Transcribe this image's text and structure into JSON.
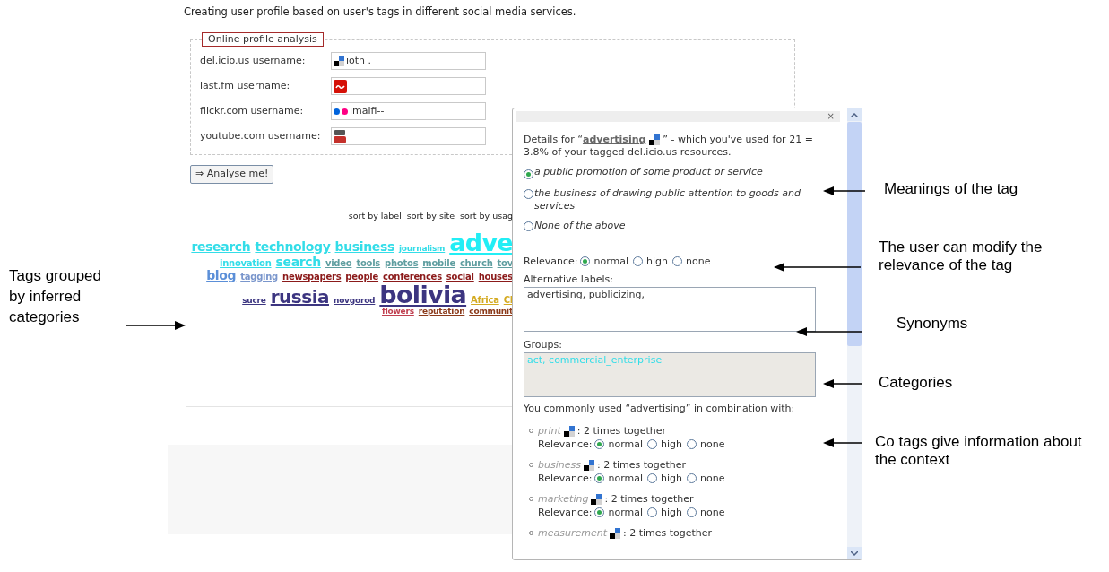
{
  "heading": "Creating user profile based on user's tags in different social media services.",
  "profile_form": {
    "legend": "Online profile analysis",
    "fields": [
      {
        "label": "del.icio.us username:",
        "kind": "delicious",
        "value": "ıoth ."
      },
      {
        "label": "last.fm username:",
        "kind": "lastfm"
      },
      {
        "label": "flickr.com username:",
        "kind": "flickr",
        "value": "ımalfi--"
      },
      {
        "label": "youtube.com username:",
        "kind": "youtube"
      }
    ],
    "submit": "⇒ Analyse me!"
  },
  "sort_links": [
    "sort by label",
    "sort by site",
    "sort by usag"
  ],
  "tag_cloud": [
    [
      {
        "label": "research",
        "color": "#33dde8",
        "kind": "m"
      },
      {
        "label": "technology",
        "color": "#33dde8",
        "kind": "m"
      },
      {
        "label": "business",
        "color": "#33dde8",
        "kind": "m"
      },
      {
        "label": "journalism",
        "color": "#33dde8",
        "kind": "xs"
      },
      {
        "label": "adve",
        "color": "#22eef5",
        "kind": "xl"
      }
    ],
    [
      {
        "label": "innovation",
        "color": "#33dde8",
        "kind": "s"
      },
      {
        "label": "search",
        "color": "#33dde8",
        "kind": "m"
      },
      {
        "label": "video",
        "color": "#5f9ea0",
        "kind": "s"
      },
      {
        "label": "tools",
        "color": "#5f9ea0",
        "kind": "s"
      },
      {
        "label": "photos",
        "color": "#5f9ea0",
        "kind": "s"
      },
      {
        "label": "mobile",
        "color": "#5f9ea0",
        "kind": "s"
      },
      {
        "label": "church",
        "color": "#5f9ea0",
        "kind": "s"
      },
      {
        "label": "tov",
        "color": "#5f9ea0",
        "kind": "s"
      }
    ],
    [
      {
        "label": "blog",
        "color": "#5b8fd8",
        "kind": "m"
      },
      {
        "label": "tagging",
        "color": "#7a96cc",
        "kind": "s"
      },
      {
        "label": "newspapers",
        "color": "#8b1a1a",
        "kind": "s"
      },
      {
        "label": "people",
        "color": "#8b1a1a",
        "kind": "s"
      },
      {
        "label": "conferences",
        "color": "#8b1a1a",
        "kind": "s"
      },
      {
        "label": "social",
        "color": "#8b1a1a",
        "kind": "s"
      },
      {
        "label": "houses",
        "color": "#8b1a1a",
        "kind": "s"
      }
    ],
    [
      {
        "label": "sucre",
        "color": "#3c3580",
        "kind": "xs"
      },
      {
        "label": "russia",
        "color": "#3c3580",
        "kind": "l"
      },
      {
        "label": "novgorod",
        "color": "#3c3580",
        "kind": "xs"
      },
      {
        "label": "bolivia",
        "color": "#3c3580",
        "kind": "xl"
      },
      {
        "label": "Africa",
        "color": "#d4aa20",
        "kind": "s"
      },
      {
        "label": "Cl",
        "color": "#d4aa20",
        "kind": "s"
      }
    ],
    [
      {
        "label": "flowers",
        "color": "#c04050",
        "kind": "xs"
      },
      {
        "label": "reputation",
        "color": "#8b3a1a",
        "kind": "xs"
      },
      {
        "label": "communit",
        "color": "#8b3a1a",
        "kind": "xs"
      }
    ]
  ],
  "popup": {
    "close": "×",
    "details": {
      "prefix": "Details for “",
      "tag": "advertising",
      "suffix": "” - which you've used for 21 = 3.8% of your tagged del.icio.us resources."
    },
    "meanings": [
      {
        "label": "a public promotion of some product or service",
        "selected": true
      },
      {
        "label": "the business of drawing public attention to goods and services",
        "selected": false
      },
      {
        "label": "None of the above",
        "selected": false
      }
    ],
    "relevance": {
      "label": "Relevance:",
      "options": [
        {
          "label": "normal",
          "selected": true
        },
        {
          "label": "high",
          "selected": false
        },
        {
          "label": "none",
          "selected": false
        }
      ]
    },
    "alternative_labels": {
      "label": "Alternative labels:",
      "value": "advertising, publicizing,"
    },
    "groups": {
      "label": "Groups:",
      "value": "act, commercial_enterprise"
    },
    "combination_intro": "You commonly used “advertising” in combination with:",
    "co_tags": [
      {
        "tag": "print",
        "count": ": 2 times together",
        "relevance": {
          "label": "Relevance:",
          "options": [
            {
              "label": "normal",
              "selected": true
            },
            {
              "label": "high",
              "selected": false
            },
            {
              "label": "none",
              "selected": false
            }
          ]
        }
      },
      {
        "tag": "business",
        "count": ": 2 times together",
        "relevance": {
          "label": "Relevance:",
          "options": [
            {
              "label": "normal",
              "selected": true
            },
            {
              "label": "high",
              "selected": false
            },
            {
              "label": "none",
              "selected": false
            }
          ]
        }
      },
      {
        "tag": "marketing",
        "count": ": 2 times together",
        "relevance": {
          "label": "Relevance:",
          "options": [
            {
              "label": "normal",
              "selected": true
            },
            {
              "label": "high",
              "selected": false
            },
            {
              "label": "none",
              "selected": false
            }
          ]
        }
      },
      {
        "tag": "measurement",
        "count": ": 2 times together"
      }
    ]
  },
  "annotations": {
    "left": "Tags grouped by inferred categories",
    "right": [
      "Meanings of the tag",
      "The user can modify the relevance of the tag",
      "Synonyms",
      "Categories",
      "Co tags give information about the context"
    ]
  }
}
